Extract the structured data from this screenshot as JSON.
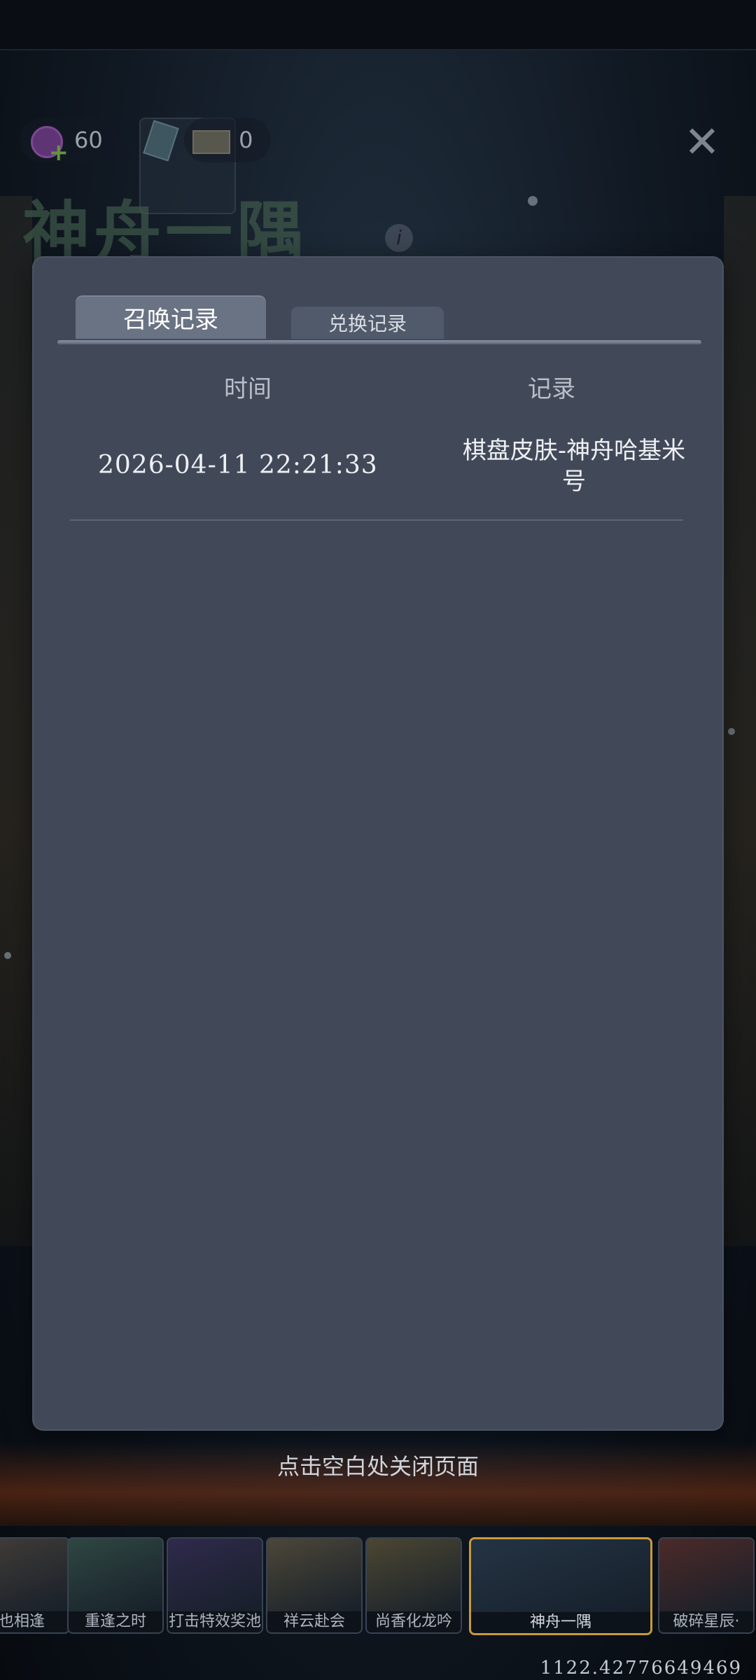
{
  "currencies": [
    {
      "icon": "candy-icon",
      "value": "60"
    },
    {
      "icon": "card-icon",
      "value": "0"
    },
    {
      "icon": "ticket-icon",
      "value": "0"
    }
  ],
  "background_title": "神舟一隅",
  "tabs": [
    {
      "label": "召唤记录",
      "active": true
    },
    {
      "label": "兑换记录",
      "active": false
    }
  ],
  "table": {
    "headers": {
      "time": "时间",
      "record": "记录"
    },
    "rows": [
      {
        "time": "2026-04-11  22:21:33",
        "record": "棋盘皮肤-神舟哈基米号"
      }
    ]
  },
  "close_hint": "点击空白处关闭页面",
  "carousel": [
    {
      "label": "也相逢",
      "color": "#5a4a3a"
    },
    {
      "label": "重逢之时",
      "color": "#3a5a4a"
    },
    {
      "label": "打击特效奖池",
      "color": "#3a2a5a"
    },
    {
      "label": "祥云赴会",
      "color": "#6a5a3a"
    },
    {
      "label": "尚香化龙吟",
      "color": "#6a5a30"
    },
    {
      "label": "神舟一隅",
      "color": "#2a3a4a",
      "selected": true
    },
    {
      "label": "破碎星辰·",
      "color": "#6a2a20"
    }
  ],
  "build_number": "1122.42776649469"
}
